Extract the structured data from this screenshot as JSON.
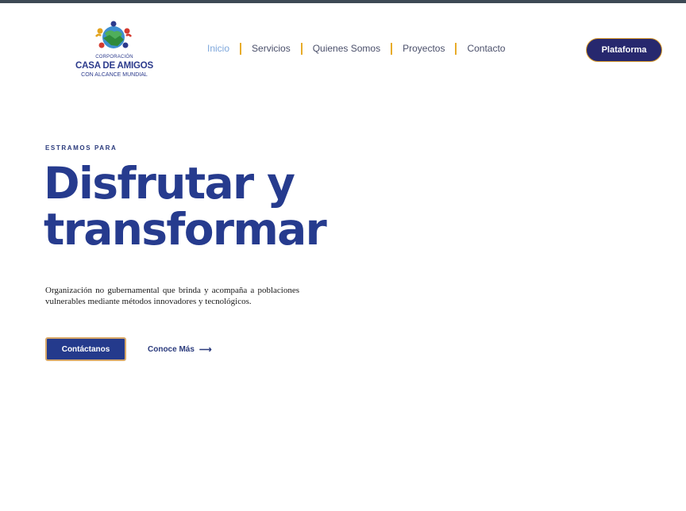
{
  "brand": {
    "tagline_small": "CORPORACIÓN",
    "name": "CASA DE AMIGOS",
    "subtitle": "CON ALCANCE MUNDIAL",
    "icon": "handshake-globe-logo",
    "colors": {
      "navy": "#2b3a8c",
      "accent": "#e8ac2a"
    }
  },
  "nav": {
    "items": [
      {
        "label": "Inicio",
        "active": true
      },
      {
        "label": "Servicios",
        "active": false
      },
      {
        "label": "Quienes Somos",
        "active": false
      },
      {
        "label": "Proyectos",
        "active": false
      },
      {
        "label": "Contacto",
        "active": false
      }
    ]
  },
  "header": {
    "platform_label": "Plataforma"
  },
  "hero": {
    "eyebrow": "ESTRAMOS PARA",
    "title_line1": "Disfrutar y",
    "title_line2": "transformar",
    "description": "Organización no gubernamental que brinda y acompaña a poblaciones vulnerables mediante métodos innovadores y tecnológicos.",
    "cta_primary": "Contáctanos",
    "cta_secondary": "Conoce Más",
    "cta_secondary_icon": "arrow-right-icon"
  }
}
